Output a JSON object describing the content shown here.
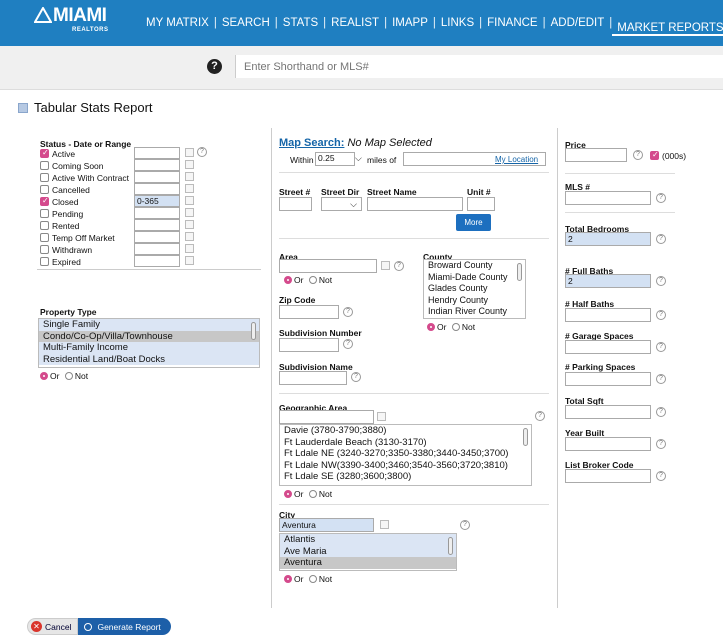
{
  "logo": {
    "text": "MIAMI",
    "sub": "REALTORS"
  },
  "nav": [
    "MY MATRIX",
    "SEARCH",
    "STATS",
    "REALIST",
    "IMAPP",
    "LINKS",
    "FINANCE",
    "ADD/EDIT",
    "MARKET REPORTS"
  ],
  "search": {
    "placeholder": "Enter Shorthand or MLS#"
  },
  "page_title": "Tabular Stats Report",
  "status": {
    "label": "Status - Date or Range",
    "items": [
      {
        "label": "Active",
        "checked": true,
        "value": ""
      },
      {
        "label": "Coming Soon",
        "checked": false,
        "value": ""
      },
      {
        "label": "Active With Contract",
        "checked": false,
        "value": ""
      },
      {
        "label": "Cancelled",
        "checked": false,
        "value": ""
      },
      {
        "label": "Closed",
        "checked": true,
        "value": "0-365"
      },
      {
        "label": "Pending",
        "checked": false,
        "value": ""
      },
      {
        "label": "Rented",
        "checked": false,
        "value": ""
      },
      {
        "label": "Temp Off Market",
        "checked": false,
        "value": ""
      },
      {
        "label": "Withdrawn",
        "checked": false,
        "value": ""
      },
      {
        "label": "Expired",
        "checked": false,
        "value": ""
      }
    ]
  },
  "property_type": {
    "label": "Property Type",
    "options": [
      "Single Family",
      "Condo/Co-Op/Villa/Townhouse",
      "Multi-Family Income",
      "Residential Land/Boat Docks"
    ],
    "or": "Or",
    "not": "Not"
  },
  "map": {
    "link": "Map Search:",
    "status": "No Map Selected",
    "within": "Within",
    "miles_value": "0.25",
    "miles_of": "miles of",
    "my_location": "My Location"
  },
  "street": {
    "num": "Street #",
    "dir": "Street Dir",
    "name": "Street Name",
    "unit": "Unit #",
    "more": "More"
  },
  "area": {
    "label": "Area",
    "or": "Or",
    "not": "Not"
  },
  "county": {
    "label": "County",
    "options": [
      "Broward County",
      "Miami-Dade County",
      "Glades County",
      "Hendry County",
      "Indian River County"
    ],
    "or": "Or",
    "not": "Not"
  },
  "zip": {
    "label": "Zip Code"
  },
  "subdiv_num": {
    "label": "Subdivision Number"
  },
  "subdiv_name": {
    "label": "Subdivision Name"
  },
  "geo": {
    "label": "Geographic Area",
    "options": [
      "Davie (3780-3790;3880)",
      "Ft Lauderdale Beach (3130-3170)",
      "Ft Ldale NE (3240-3270;3350-3380;3440-3450;3700)",
      "Ft Ldale NW(3390-3400;3460;3540-3560;3720;3810)",
      "Ft Ldale SE (3280;3600;3800)"
    ],
    "or": "Or",
    "not": "Not"
  },
  "city": {
    "label": "City",
    "value": "Aventura",
    "options": [
      "Atlantis",
      "Ave Maria",
      "Aventura"
    ],
    "or": "Or",
    "not": "Not"
  },
  "right": {
    "price": "Price",
    "thousands": "(000s)",
    "mls": "MLS #",
    "bedrooms": "Total Bedrooms",
    "bedrooms_value": "2",
    "full_baths": "# Full Baths",
    "full_baths_value": "2",
    "half_baths": "# Half Baths",
    "garage": "# Garage Spaces",
    "parking": "# Parking Spaces",
    "sqft": "Total Sqft",
    "year": "Year Built",
    "broker": "List Broker Code"
  },
  "buttons": {
    "cancel": "Cancel",
    "generate": "Generate Report"
  }
}
